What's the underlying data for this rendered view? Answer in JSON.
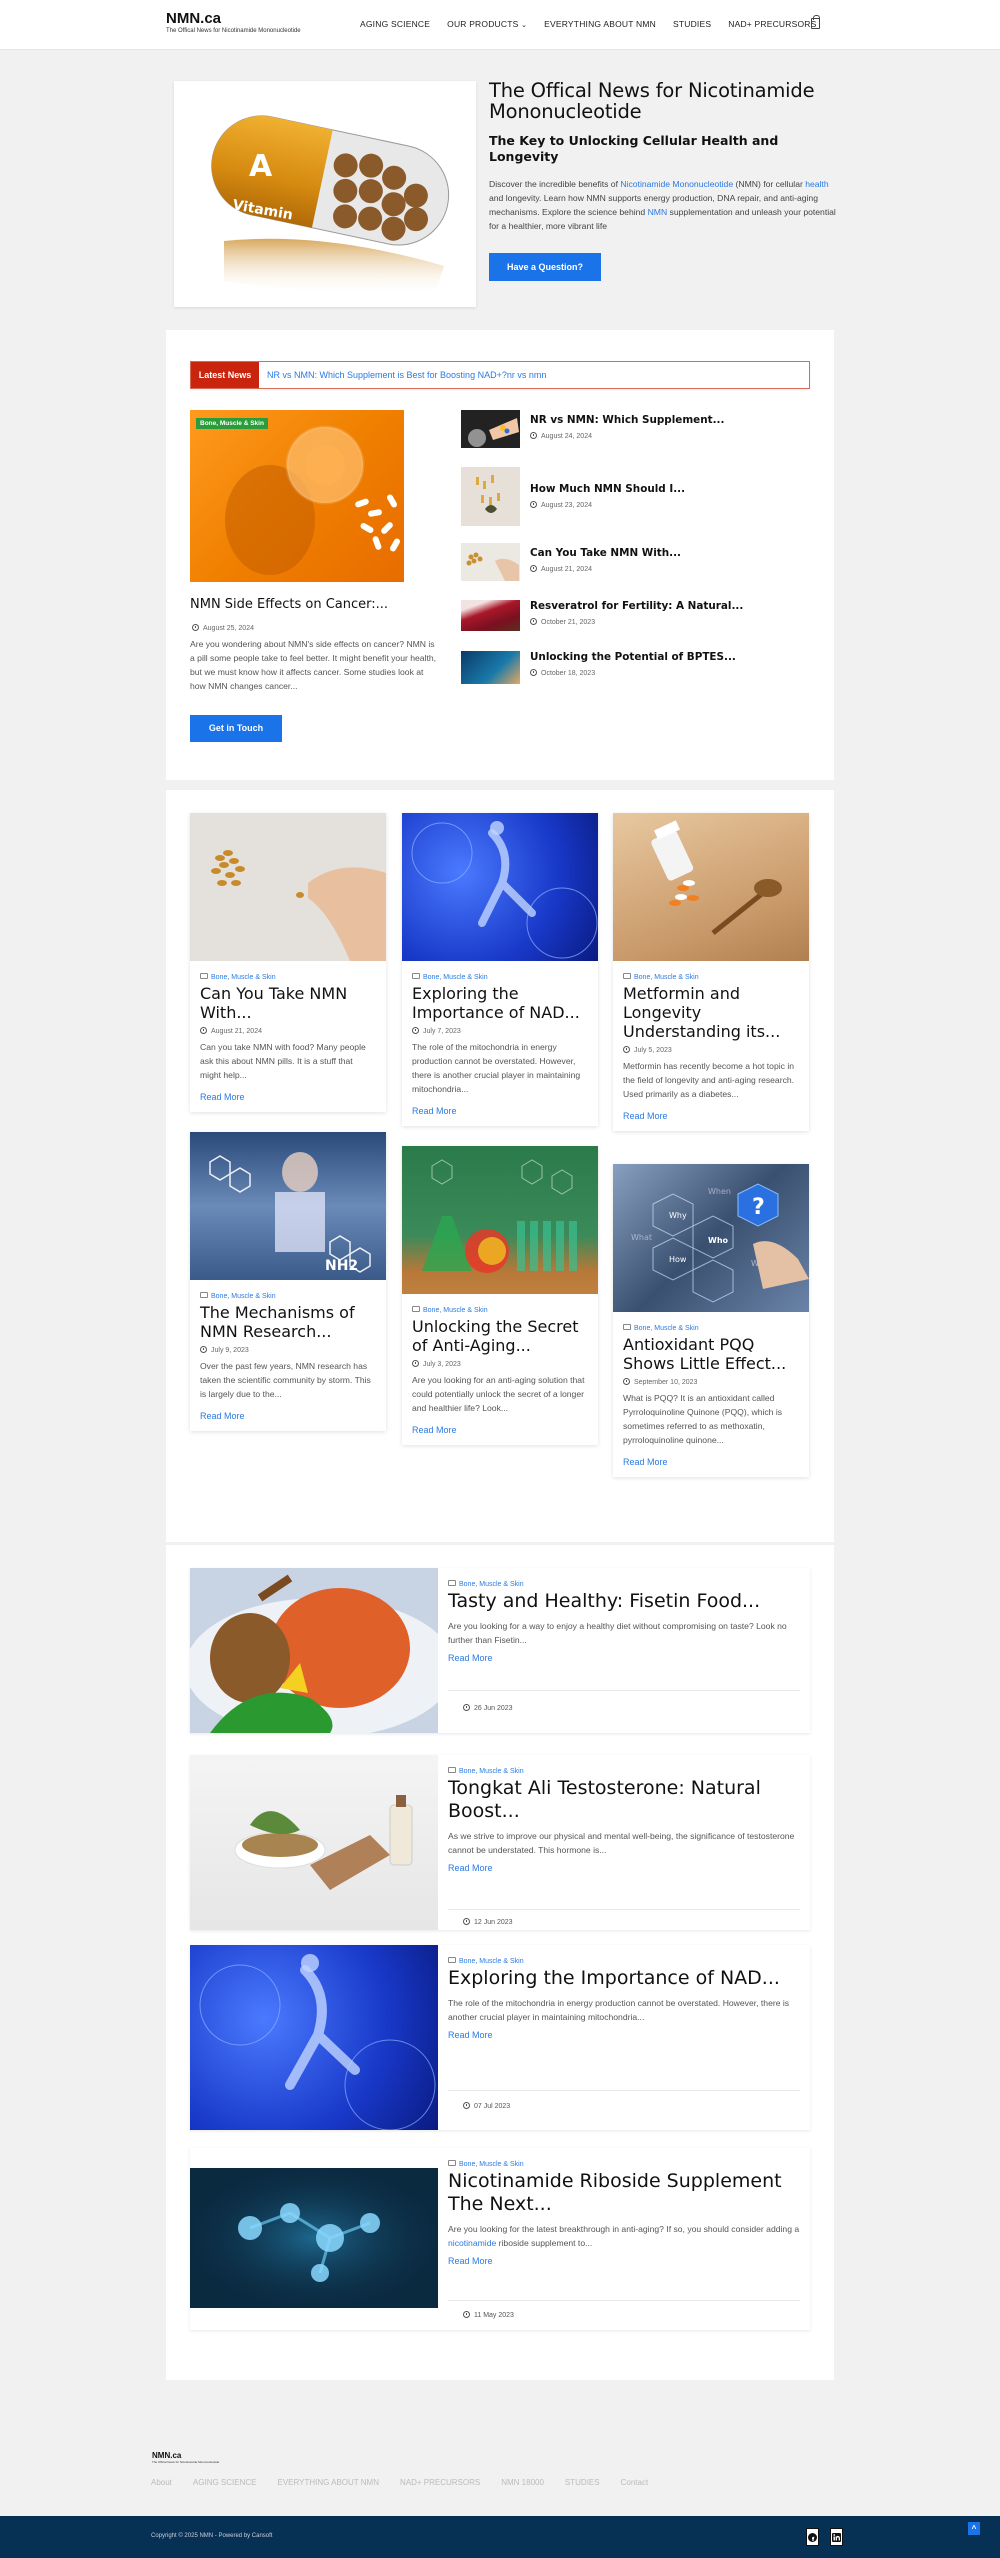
{
  "header": {
    "logo_title": "NMN.ca",
    "logo_subtitle": "The Offical News for Nicotinamide Mononucleotide",
    "nav": [
      "AGING SCIENCE",
      "OUR PRODUCTS",
      "EVERYTHING ABOUT NMN",
      "STUDIES",
      "NAD+ PRECURSORS"
    ],
    "cart_icon": "shopping-bag-icon"
  },
  "hero": {
    "image_alt": "Vitamin A capsule",
    "image_label_letter": "A",
    "image_label_word": "Vitamin",
    "title": "The Offical News for Nicotinamide Mononucleotide",
    "subtitle": "The Key to Unlocking Cellular Health and Longevity",
    "text_1": "Discover the incredible benefits of ",
    "link_1": "Nicotinamide Mononucleotide",
    "text_2": " (NMN) for cellular ",
    "link_2": "health",
    "text_3": " and longevity. Learn how NMN supports energy production, DNA repair, and anti-aging mechanisms. Explore the science behind ",
    "link_3": "NMN",
    "text_4": " supplementation and unleash your potential for a healthier, more vibrant life",
    "button": "Have a Question?"
  },
  "latest": {
    "label": "Latest News",
    "ticker": "NR vs NMN: Which Supplement is Best for Boosting NAD+?nr vs nmn",
    "featured": {
      "badge": "Bone, Muscle & Skin",
      "title": "NMN Side Effects on Cancer:...",
      "date": "August 25, 2024",
      "excerpt": "Are you wondering about NMN's side effects on cancer? NMN is a pill some people take to feel better. It might benefit your health, but we must know how it affects cancer. Some studies look at how NMN changes cancer...",
      "button": "Get in Touch"
    },
    "side": [
      {
        "title": "NR vs NMN: Which Supplement...",
        "date": "August 24, 2024"
      },
      {
        "title": "How Much NMN Should I...",
        "date": "August 23, 2024"
      },
      {
        "title": "Can You Take NMN With...",
        "date": "August 21, 2024"
      },
      {
        "title": "Resveratrol for Fertility: A Natural...",
        "date": "October 21, 2023"
      },
      {
        "title": "Unlocking the Potential of BPTES...",
        "date": "October 18, 2023"
      }
    ]
  },
  "grid": [
    {
      "category": "Bone, Muscle & Skin",
      "title": "Can You Take NMN With...",
      "date": "August 21, 2024",
      "excerpt": "Can you take NMN with food? Many people ask this about NMN pills. It is a stuff that might help...",
      "read_more": "Read More"
    },
    {
      "category": "Bone, Muscle & Skin",
      "title": "Exploring the Importance of NAD...",
      "date": "July 7, 2023",
      "excerpt": "The role of the mitochondria in energy production cannot be overstated. However, there is another crucial player in maintaining mitochondria...",
      "read_more": "Read More"
    },
    {
      "category": "Bone, Muscle & Skin",
      "title": "Metformin and Longevity Understanding its...",
      "date": "July 5, 2023",
      "excerpt": "Metformin has recently become a hot topic in the field of longevity and anti-aging research. Used primarily as a diabetes...",
      "read_more": "Read More"
    },
    {
      "category": "Bone, Muscle & Skin",
      "title": "The Mechanisms of NMN Research...",
      "date": "July 9, 2023",
      "excerpt": "Over the past few years, NMN research has taken the scientific community by storm. This is largely due to the...",
      "read_more": "Read More"
    },
    {
      "category": "Bone, Muscle & Skin",
      "title": "Unlocking the Secret of Anti-Aging...",
      "date": "July 3, 2023",
      "excerpt": "Are you looking for an anti-aging solution that could potentially unlock the secret of a longer and healthier life? Look...",
      "read_more": "Read More"
    },
    {
      "category": "Bone, Muscle & Skin",
      "title": "Antioxidant PQQ Shows Little Effect...",
      "date": "September 10, 2023",
      "excerpt": "What is PQQ? It is an antioxidant called Pyrroloquinoline Quinone (PQQ), which is sometimes referred to as methoxatin, pyrroloquinoline quinone...",
      "read_more": "Read More"
    }
  ],
  "grid_image_words": {
    "why": "Why",
    "who": "Who",
    "how": "How",
    "what": "What",
    "when": "When",
    "where": "Where",
    "nh2": "NH2"
  },
  "list": [
    {
      "category": "Bone, Muscle & Skin",
      "title": "Tasty and Healthy: Fisetin Food...",
      "excerpt": "Are you looking for a way to enjoy a healthy diet without compromising on taste? Look no further than Fisetin...",
      "read_more": "Read More",
      "date": "26 Jun 2023"
    },
    {
      "category": "Bone, Muscle & Skin",
      "title": "Tongkat Ali Testosterone: Natural Boost...",
      "excerpt": "As we strive to improve our physical and mental well-being, the significance of testosterone cannot be understated. This hormone is...",
      "read_more": "Read More",
      "date": "12 Jun 2023"
    },
    {
      "category": "Bone, Muscle & Skin",
      "title": "Exploring the Importance of NAD...",
      "excerpt": "The role of the mitochondria in energy production cannot be overstated. However, there is another crucial player in maintaining mitochondria...",
      "read_more": "Read More",
      "date": "07 Jul 2023"
    },
    {
      "category": "Bone, Muscle & Skin",
      "title": "Nicotinamide Riboside Supplement The Next...",
      "excerpt_1": "Are you looking for the latest breakthrough in anti-aging? If so, you should consider adding a ",
      "excerpt_link": "nicotinamide",
      "excerpt_2": " riboside supplement to...",
      "read_more": "Read More",
      "date": "11 May 2023"
    }
  ],
  "footer": {
    "logo_title": "NMN.ca",
    "logo_subtitle": "The Offical News for Nicotinamide Mononucleotide",
    "nav": [
      "About",
      "AGING SCIENCE",
      "EVERYTHING ABOUT NMN",
      "NAD+ PRECURSORS",
      "NMN 18000",
      "STUDIES",
      "Contact"
    ],
    "copyright": "Copyright © 2025 NMN - Powered by Cansoft",
    "social": [
      "facebook-icon",
      "linkedin-icon"
    ],
    "scroll_top": "^"
  },
  "colors": {
    "accent": "#1a73e8",
    "link": "#2a7ae2",
    "ticker_red": "#c9250e",
    "badge_green": "#2a9d3a",
    "footer_bg": "#073154"
  }
}
